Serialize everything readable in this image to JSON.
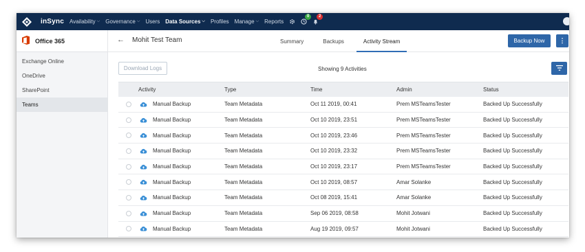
{
  "nav": {
    "brand": "inSync",
    "items": [
      {
        "label": "Availability",
        "caret": true,
        "active": false
      },
      {
        "label": "Governance",
        "caret": true,
        "active": false
      },
      {
        "label": "Users",
        "caret": false,
        "active": false
      },
      {
        "label": "Data Sources",
        "caret": true,
        "active": true
      },
      {
        "label": "Profiles",
        "caret": false,
        "active": false
      },
      {
        "label": "Manage",
        "caret": true,
        "active": false
      },
      {
        "label": "Reports",
        "caret": false,
        "active": false
      }
    ],
    "job_badge": "0",
    "alert_badge": "2",
    "icons": [
      "settings-icon",
      "jobs-icon",
      "bell-icon",
      "user-icon"
    ]
  },
  "sidebar": {
    "title": "Office 365",
    "items": [
      {
        "label": "Exchange Online",
        "active": false
      },
      {
        "label": "OneDrive",
        "active": false
      },
      {
        "label": "SharePoint",
        "active": false
      },
      {
        "label": "Teams",
        "active": true
      }
    ]
  },
  "header": {
    "title": "Mohit Test Team",
    "tabs": [
      {
        "label": "Summary",
        "active": false
      },
      {
        "label": "Backups",
        "active": false
      },
      {
        "label": "Activity Stream",
        "active": true
      }
    ],
    "backup_button": "Backup Now",
    "more_button": "⋮"
  },
  "toolbar": {
    "download_logs": "Download Logs",
    "showing": "Showing 9 Activities"
  },
  "table": {
    "columns": [
      "Activity",
      "Type",
      "Time",
      "Admin",
      "Status"
    ],
    "rows": [
      {
        "activity": "Manual Backup",
        "type": "Team Metadata",
        "time": "Oct 11 2019, 00:41",
        "admin": "Prem MSTeamsTester",
        "status": "Backed Up Successfully"
      },
      {
        "activity": "Manual Backup",
        "type": "Team Metadata",
        "time": "Oct 10 2019, 23:51",
        "admin": "Prem MSTeamsTester",
        "status": "Backed Up Successfully"
      },
      {
        "activity": "Manual Backup",
        "type": "Team Metadata",
        "time": "Oct 10 2019, 23:46",
        "admin": "Prem MSTeamsTester",
        "status": "Backed Up Successfully"
      },
      {
        "activity": "Manual Backup",
        "type": "Team Metadata",
        "time": "Oct 10 2019, 23:32",
        "admin": "Prem MSTeamsTester",
        "status": "Backed Up Successfully"
      },
      {
        "activity": "Manual Backup",
        "type": "Team Metadata",
        "time": "Oct 10 2019, 23:17",
        "admin": "Prem MSTeamsTester",
        "status": "Backed Up Successfully"
      },
      {
        "activity": "Manual Backup",
        "type": "Team Metadata",
        "time": "Oct 10 2019, 08:57",
        "admin": "Amar Solanke",
        "status": "Backed Up Successfully"
      },
      {
        "activity": "Manual Backup",
        "type": "Team Metadata",
        "time": "Oct 08 2019, 15:41",
        "admin": "Amar Solanke",
        "status": "Backed Up Successfully"
      },
      {
        "activity": "Manual Backup",
        "type": "Team Metadata",
        "time": "Sep 06 2019, 08:58",
        "admin": "Mohit Jotwani",
        "status": "Backed Up Successfully"
      },
      {
        "activity": "Manual Backup",
        "type": "Team Metadata",
        "time": "Aug 19 2019, 09:57",
        "admin": "Mohit Jotwani",
        "status": "Backed Up Successfully"
      }
    ]
  },
  "colors": {
    "nav_bg": "#0f2b4f",
    "primary": "#2e66a8",
    "office_red": "#d83b01",
    "cloud_blue": "#3a8fd6"
  }
}
